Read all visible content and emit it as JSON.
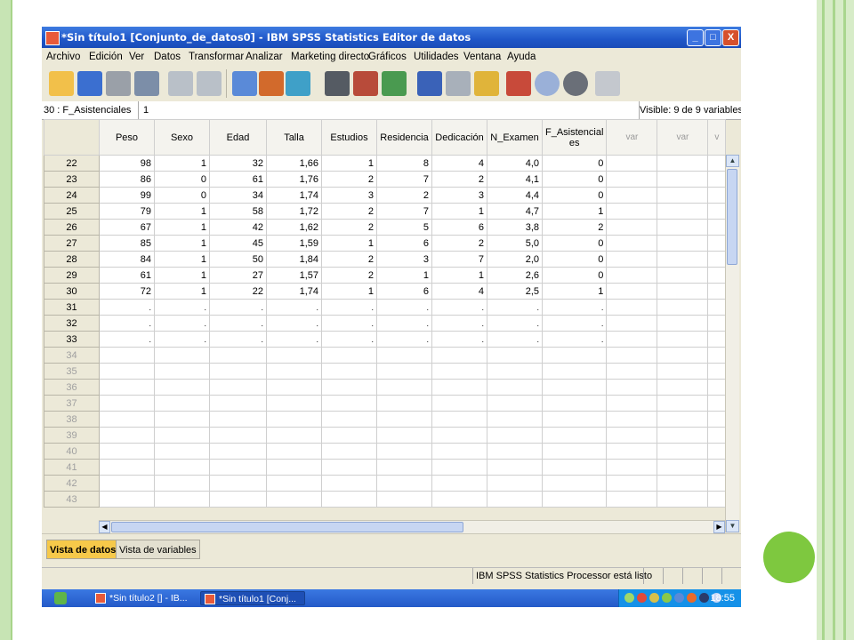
{
  "window": {
    "title": "*Sin título1 [Conjunto_de_datos0] - IBM SPSS Statistics Editor de datos",
    "controls": [
      "_",
      "□",
      "X"
    ]
  },
  "menu": [
    "Archivo",
    "Edición",
    "Ver",
    "Datos",
    "Transformar",
    "Analizar",
    "Marketing directo",
    "Gráficos",
    "Utilidades",
    "Ventana",
    "Ayuda"
  ],
  "toolbar_icons": [
    "open-folder-icon",
    "save-icon",
    "print-icon",
    "dialog-recall-icon",
    "undo-icon",
    "redo-icon",
    "goto-case-icon",
    "goto-variable-icon",
    "variables-icon",
    "find-icon",
    "insert-cases-icon",
    "insert-variable-icon",
    "split-file-icon",
    "weight-cases-icon",
    "select-cases-icon",
    "value-labels-icon",
    "use-sets-icon",
    "show-all-variables-icon",
    "spell-check-icon"
  ],
  "cell_editor": {
    "reference": "30 : F_Asistenciales",
    "value": "1",
    "visible": "Visible: 9 de 9 variables"
  },
  "columns": [
    "Peso",
    "Sexo",
    "Edad",
    "Talla",
    "Estudios",
    "Residencia",
    "Dedicación",
    "N_Examen",
    "F_Asistenciales"
  ],
  "columns_display": [
    "Peso",
    "Sexo",
    "Edad",
    "Talla",
    "Estudios",
    "Residencia",
    "Dedicación",
    "N_Examen",
    "F_Asistencial es"
  ],
  "empty_columns": [
    "var",
    "var",
    "v"
  ],
  "rows": [
    {
      "n": "22",
      "cells": [
        "98",
        "1",
        "32",
        "1,66",
        "1",
        "8",
        "4",
        "4,0",
        "0"
      ]
    },
    {
      "n": "23",
      "cells": [
        "86",
        "0",
        "61",
        "1,76",
        "2",
        "7",
        "2",
        "4,1",
        "0"
      ]
    },
    {
      "n": "24",
      "cells": [
        "99",
        "0",
        "34",
        "1,74",
        "3",
        "2",
        "3",
        "4,4",
        "0"
      ]
    },
    {
      "n": "25",
      "cells": [
        "79",
        "1",
        "58",
        "1,72",
        "2",
        "7",
        "1",
        "4,7",
        "1"
      ]
    },
    {
      "n": "26",
      "cells": [
        "67",
        "1",
        "42",
        "1,62",
        "2",
        "5",
        "6",
        "3,8",
        "2"
      ]
    },
    {
      "n": "27",
      "cells": [
        "85",
        "1",
        "45",
        "1,59",
        "1",
        "6",
        "2",
        "5,0",
        "0"
      ]
    },
    {
      "n": "28",
      "cells": [
        "84",
        "1",
        "50",
        "1,84",
        "2",
        "3",
        "7",
        "2,0",
        "0"
      ]
    },
    {
      "n": "29",
      "cells": [
        "61",
        "1",
        "27",
        "1,57",
        "2",
        "1",
        "1",
        "2,6",
        "0"
      ]
    },
    {
      "n": "30",
      "cells": [
        "72",
        "1",
        "22",
        "1,74",
        "1",
        "6",
        "4",
        "2,5",
        "1"
      ]
    },
    {
      "n": "31",
      "cells": [
        ".",
        ".",
        ".",
        ".",
        ".",
        ".",
        ".",
        ".",
        "."
      ]
    },
    {
      "n": "32",
      "cells": [
        ".",
        ".",
        ".",
        ".",
        ".",
        ".",
        ".",
        ".",
        "."
      ]
    },
    {
      "n": "33",
      "cells": [
        ".",
        ".",
        ".",
        ".",
        ".",
        ".",
        ".",
        ".",
        "."
      ]
    },
    {
      "n": "34",
      "cells": [
        "",
        "",
        "",
        "",
        "",
        "",
        "",
        "",
        ""
      ],
      "dim": true
    },
    {
      "n": "35",
      "cells": [
        "",
        "",
        "",
        "",
        "",
        "",
        "",
        "",
        ""
      ],
      "dim": true
    },
    {
      "n": "36",
      "cells": [
        "",
        "",
        "",
        "",
        "",
        "",
        "",
        "",
        ""
      ],
      "dim": true
    },
    {
      "n": "37",
      "cells": [
        "",
        "",
        "",
        "",
        "",
        "",
        "",
        "",
        ""
      ],
      "dim": true
    },
    {
      "n": "38",
      "cells": [
        "",
        "",
        "",
        "",
        "",
        "",
        "",
        "",
        ""
      ],
      "dim": true
    },
    {
      "n": "39",
      "cells": [
        "",
        "",
        "",
        "",
        "",
        "",
        "",
        "",
        ""
      ],
      "dim": true
    },
    {
      "n": "40",
      "cells": [
        "",
        "",
        "",
        "",
        "",
        "",
        "",
        "",
        ""
      ],
      "dim": true
    },
    {
      "n": "41",
      "cells": [
        "",
        "",
        "",
        "",
        "",
        "",
        "",
        "",
        ""
      ],
      "dim": true
    },
    {
      "n": "42",
      "cells": [
        "",
        "",
        "",
        "",
        "",
        "",
        "",
        "",
        ""
      ],
      "dim": true
    },
    {
      "n": "43",
      "cells": [
        "",
        "",
        "",
        "",
        "",
        "",
        "",
        "",
        ""
      ],
      "dim": true
    }
  ],
  "tabs": {
    "data_view": "Vista de datos",
    "variable_view": "Vista de variables"
  },
  "status": "IBM SPSS Statistics Processor está listo",
  "taskbar": {
    "task1": "*Sin título2 [] - IB...",
    "task2": "*Sin título1 [Conj...",
    "clock": "18:55"
  },
  "colors": {
    "title_bar": "#1f56c8",
    "active_tab": "#f6c94a",
    "accent_green": "#7ec83f"
  }
}
